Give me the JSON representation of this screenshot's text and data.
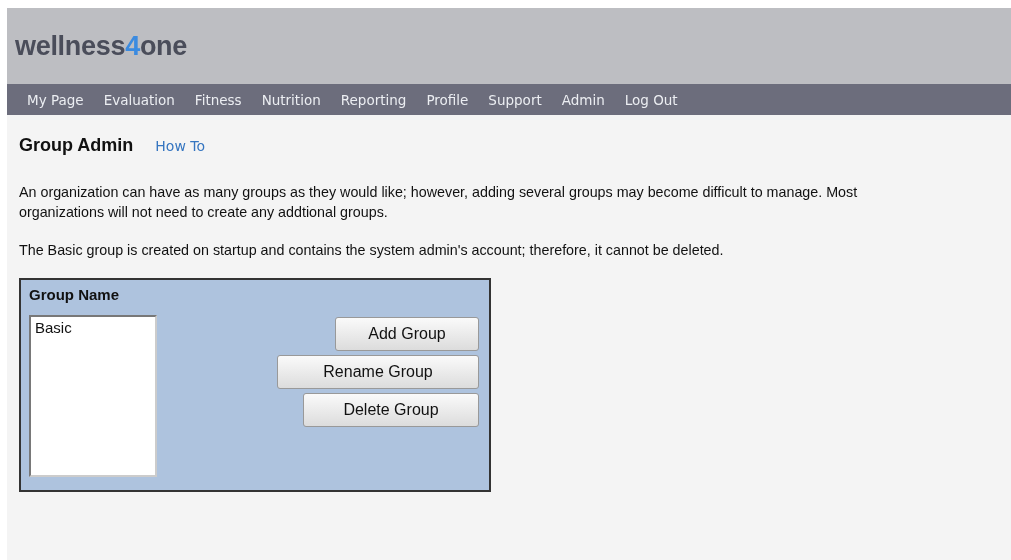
{
  "logo": {
    "text_before": "wellness",
    "accent": "4",
    "text_after": "one"
  },
  "nav": [
    {
      "label": "My Page"
    },
    {
      "label": "Evaluation"
    },
    {
      "label": "Fitness"
    },
    {
      "label": "Nutrition"
    },
    {
      "label": "Reporting"
    },
    {
      "label": "Profile"
    },
    {
      "label": "Support"
    },
    {
      "label": "Admin"
    },
    {
      "label": "Log Out"
    }
  ],
  "page_title": "Group Admin",
  "help_link": "How To",
  "paragraphs": [
    "An organization can have as many groups as they would like; however, adding several groups may become difficult to manage.  Most organizations will not need to create any addtional groups.",
    "The Basic group is created on startup and contains the system admin's account; therefore, it cannot be deleted."
  ],
  "group_panel": {
    "heading": "Group Name",
    "groups": [
      {
        "name": "Basic",
        "selected": false
      }
    ],
    "buttons": [
      {
        "label": "Add Group"
      },
      {
        "label": "Rename Group"
      },
      {
        "label": "Delete Group"
      }
    ]
  }
}
